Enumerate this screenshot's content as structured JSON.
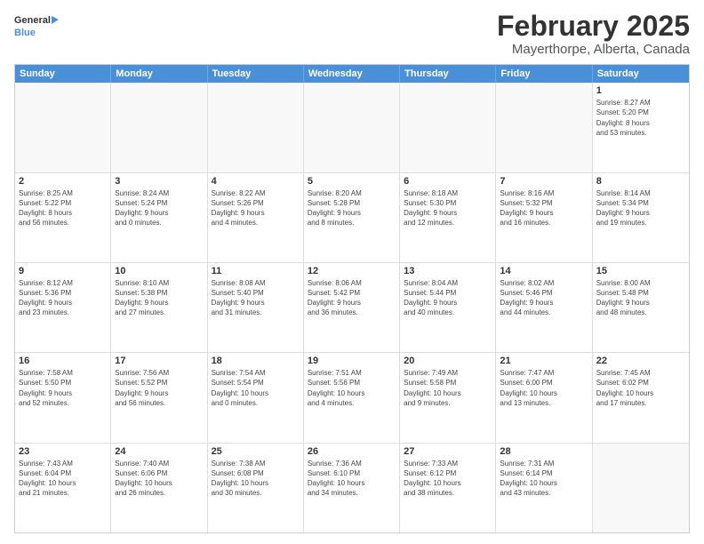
{
  "header": {
    "logo_general": "General",
    "logo_blue": "Blue",
    "title": "February 2025",
    "subtitle": "Mayerthorpe, Alberta, Canada"
  },
  "calendar": {
    "days_of_week": [
      "Sunday",
      "Monday",
      "Tuesday",
      "Wednesday",
      "Thursday",
      "Friday",
      "Saturday"
    ],
    "rows": [
      [
        {
          "day": "",
          "info": ""
        },
        {
          "day": "",
          "info": ""
        },
        {
          "day": "",
          "info": ""
        },
        {
          "day": "",
          "info": ""
        },
        {
          "day": "",
          "info": ""
        },
        {
          "day": "",
          "info": ""
        },
        {
          "day": "1",
          "info": "Sunrise: 8:27 AM\nSunset: 5:20 PM\nDaylight: 8 hours\nand 53 minutes."
        }
      ],
      [
        {
          "day": "2",
          "info": "Sunrise: 8:25 AM\nSunset: 5:22 PM\nDaylight: 8 hours\nand 56 minutes."
        },
        {
          "day": "3",
          "info": "Sunrise: 8:24 AM\nSunset: 5:24 PM\nDaylight: 9 hours\nand 0 minutes."
        },
        {
          "day": "4",
          "info": "Sunrise: 8:22 AM\nSunset: 5:26 PM\nDaylight: 9 hours\nand 4 minutes."
        },
        {
          "day": "5",
          "info": "Sunrise: 8:20 AM\nSunset: 5:28 PM\nDaylight: 9 hours\nand 8 minutes."
        },
        {
          "day": "6",
          "info": "Sunrise: 8:18 AM\nSunset: 5:30 PM\nDaylight: 9 hours\nand 12 minutes."
        },
        {
          "day": "7",
          "info": "Sunrise: 8:16 AM\nSunset: 5:32 PM\nDaylight: 9 hours\nand 16 minutes."
        },
        {
          "day": "8",
          "info": "Sunrise: 8:14 AM\nSunset: 5:34 PM\nDaylight: 9 hours\nand 19 minutes."
        }
      ],
      [
        {
          "day": "9",
          "info": "Sunrise: 8:12 AM\nSunset: 5:36 PM\nDaylight: 9 hours\nand 23 minutes."
        },
        {
          "day": "10",
          "info": "Sunrise: 8:10 AM\nSunset: 5:38 PM\nDaylight: 9 hours\nand 27 minutes."
        },
        {
          "day": "11",
          "info": "Sunrise: 8:08 AM\nSunset: 5:40 PM\nDaylight: 9 hours\nand 31 minutes."
        },
        {
          "day": "12",
          "info": "Sunrise: 8:06 AM\nSunset: 5:42 PM\nDaylight: 9 hours\nand 36 minutes."
        },
        {
          "day": "13",
          "info": "Sunrise: 8:04 AM\nSunset: 5:44 PM\nDaylight: 9 hours\nand 40 minutes."
        },
        {
          "day": "14",
          "info": "Sunrise: 8:02 AM\nSunset: 5:46 PM\nDaylight: 9 hours\nand 44 minutes."
        },
        {
          "day": "15",
          "info": "Sunrise: 8:00 AM\nSunset: 5:48 PM\nDaylight: 9 hours\nand 48 minutes."
        }
      ],
      [
        {
          "day": "16",
          "info": "Sunrise: 7:58 AM\nSunset: 5:50 PM\nDaylight: 9 hours\nand 52 minutes."
        },
        {
          "day": "17",
          "info": "Sunrise: 7:56 AM\nSunset: 5:52 PM\nDaylight: 9 hours\nand 56 minutes."
        },
        {
          "day": "18",
          "info": "Sunrise: 7:54 AM\nSunset: 5:54 PM\nDaylight: 10 hours\nand 0 minutes."
        },
        {
          "day": "19",
          "info": "Sunrise: 7:51 AM\nSunset: 5:56 PM\nDaylight: 10 hours\nand 4 minutes."
        },
        {
          "day": "20",
          "info": "Sunrise: 7:49 AM\nSunset: 5:58 PM\nDaylight: 10 hours\nand 9 minutes."
        },
        {
          "day": "21",
          "info": "Sunrise: 7:47 AM\nSunset: 6:00 PM\nDaylight: 10 hours\nand 13 minutes."
        },
        {
          "day": "22",
          "info": "Sunrise: 7:45 AM\nSunset: 6:02 PM\nDaylight: 10 hours\nand 17 minutes."
        }
      ],
      [
        {
          "day": "23",
          "info": "Sunrise: 7:43 AM\nSunset: 6:04 PM\nDaylight: 10 hours\nand 21 minutes."
        },
        {
          "day": "24",
          "info": "Sunrise: 7:40 AM\nSunset: 6:06 PM\nDaylight: 10 hours\nand 26 minutes."
        },
        {
          "day": "25",
          "info": "Sunrise: 7:38 AM\nSunset: 6:08 PM\nDaylight: 10 hours\nand 30 minutes."
        },
        {
          "day": "26",
          "info": "Sunrise: 7:36 AM\nSunset: 6:10 PM\nDaylight: 10 hours\nand 34 minutes."
        },
        {
          "day": "27",
          "info": "Sunrise: 7:33 AM\nSunset: 6:12 PM\nDaylight: 10 hours\nand 38 minutes."
        },
        {
          "day": "28",
          "info": "Sunrise: 7:31 AM\nSunset: 6:14 PM\nDaylight: 10 hours\nand 43 minutes."
        },
        {
          "day": "",
          "info": ""
        }
      ]
    ]
  }
}
